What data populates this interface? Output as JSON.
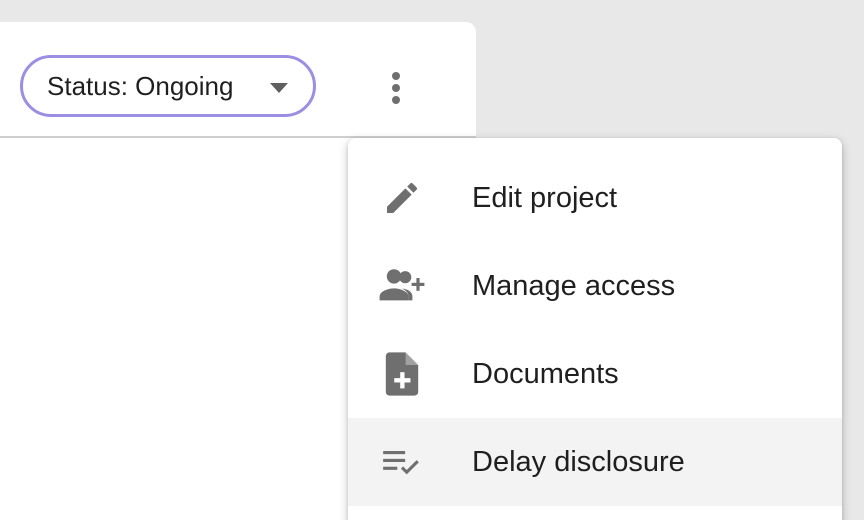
{
  "header": {
    "status_label": "Status: Ongoing"
  },
  "menu": {
    "items": [
      {
        "label": "Edit project",
        "icon": "pencil-icon"
      },
      {
        "label": "Manage access",
        "icon": "person-add-icon"
      },
      {
        "label": "Documents",
        "icon": "document-add-icon"
      },
      {
        "label": "Delay disclosure",
        "icon": "playlist-check-icon"
      }
    ]
  },
  "colors": {
    "pill_border": "#9b8fe3",
    "icon": "#6f6f6f",
    "hover_bg": "#f3f3f3"
  }
}
